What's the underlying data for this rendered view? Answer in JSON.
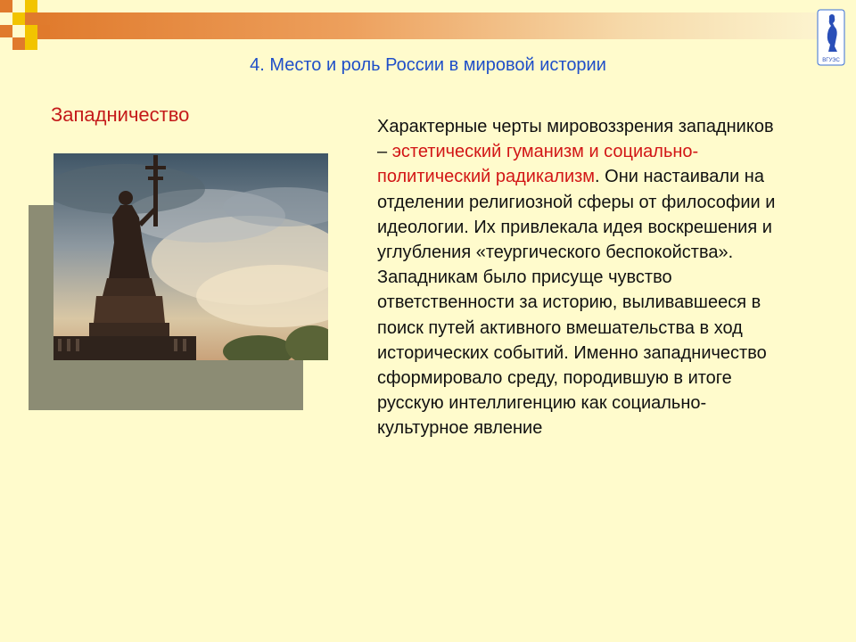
{
  "title": "4. Место и роль России в мировой истории",
  "section_title": "Западничество",
  "body": {
    "p1_start": "Характерные черты мировоззрения западников – ",
    "highlight": "эстетический гуманизм и социально-политический радикализм",
    "p1_end": ". Они настаивали на отделении религиозной сферы от философии и идеологии. Их привлекала идея воскрешения и углубления «теургического беспокойства». Западникам было присуще чувство ответственности за историю, выливавшееся в поиск путей активного вмешательства в ход исторических событий. Именно западничество сформировало среду, породившую в итоге русскую интеллигенцию как социально-культурное явление"
  },
  "logo_text": "ВГУЭС",
  "colors": {
    "background": "#fffbcc",
    "title": "#1f4fc8",
    "section": "#c41a1a",
    "highlight": "#d21616",
    "accent_orange": "#e07a2c",
    "accent_yellow": "#f2c400"
  },
  "icons": [
    "university-logo-icon",
    "statue-photo"
  ]
}
